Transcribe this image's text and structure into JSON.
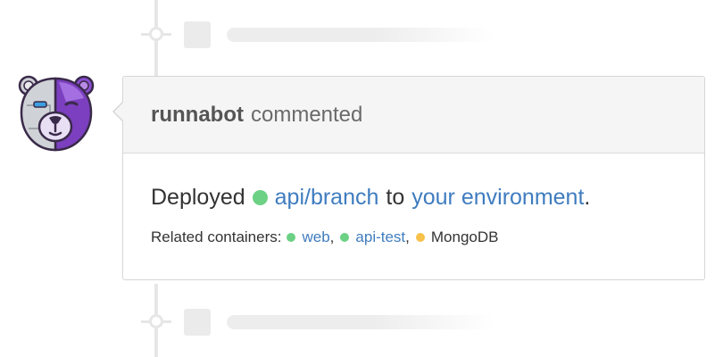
{
  "comment": {
    "author": "runnabot",
    "action": "commented",
    "deploy": {
      "prefix": "Deployed",
      "branch_link": "api/branch",
      "middle": "to",
      "environment_link": "your environment",
      "suffix": ".",
      "status_color": "#6cd184"
    },
    "related": {
      "label": "Related containers:",
      "containers": [
        {
          "name": "web",
          "status_color": "#6cd184",
          "is_link": true,
          "separator": ","
        },
        {
          "name": "api-test",
          "status_color": "#6cd184",
          "is_link": true,
          "separator": ","
        },
        {
          "name": "MongoDB",
          "status_color": "#f7c14a",
          "is_link": false,
          "separator": ""
        }
      ]
    }
  },
  "colors": {
    "link": "#3f7cbf",
    "running": "#6cd184",
    "building": "#f7c14a",
    "avatar_purple": "#7b3fbf"
  },
  "icons": {
    "avatar": "runnabot-bear-avatar",
    "timeline_node": "timeline-node-icon"
  }
}
